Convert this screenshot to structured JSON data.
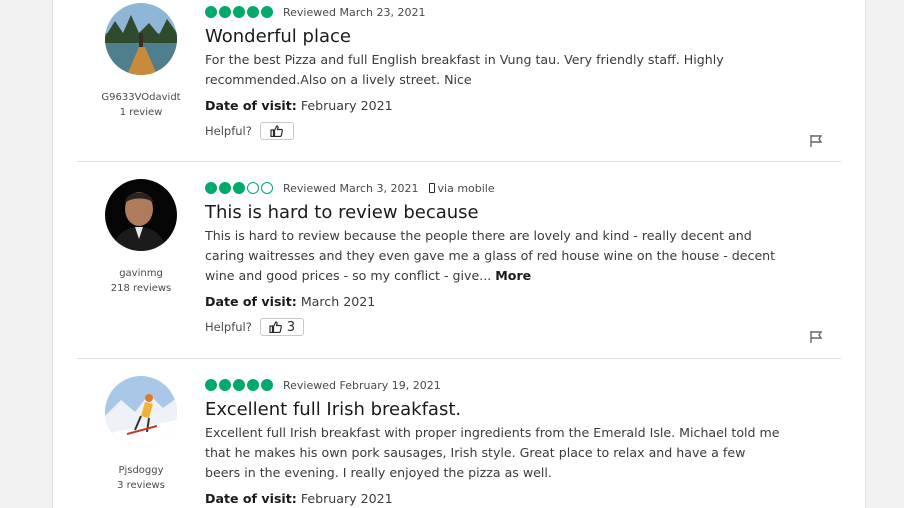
{
  "reviews": [
    {
      "username": "G9633VOdavidt",
      "review_count": "1 review",
      "rating": 5,
      "reviewed_date": "Reviewed March 23, 2021",
      "via": "",
      "title": "Wonderful place",
      "body_lines": [
        "For the best Pizza and full English breakfast in Vung tau. Very friendly staff. Highly",
        "recommended.Also on a lively street. Nice"
      ],
      "more": "",
      "date_label": "Date of visit:",
      "date_value": " February 2021",
      "helpful_label": "Helpful?",
      "helpful_count": ""
    },
    {
      "username": "gavinmg",
      "review_count": "218 reviews",
      "rating": 3,
      "reviewed_date": "Reviewed March 3, 2021",
      "via": "via mobile",
      "title": "This is hard to review because",
      "body_lines": [
        "This is hard to review because the people there are lovely and kind - really decent and",
        "caring waitresses and they even gave me a glass of red house wine on the house - decent",
        "wine and good prices - so my conflict - give..."
      ],
      "more": "More",
      "date_label": "Date of visit:",
      "date_value": " March 2021",
      "helpful_label": "Helpful?",
      "helpful_count": "3"
    },
    {
      "username": "Pjsdoggy",
      "review_count": "3 reviews",
      "rating": 5,
      "reviewed_date": "Reviewed February 19, 2021",
      "via": "",
      "title": "Excellent full Irish breakfast.",
      "body_lines": [
        "Excellent full Irish breakfast with proper ingredients from the Emerald Isle. Michael told me",
        "that he makes his own pork sausages, Irish style. Great place to relax and have a few",
        "beers in the evening. I really enjoyed the pizza as well."
      ],
      "more": "",
      "date_label": "Date of visit:",
      "date_value": " February 2021"
    }
  ],
  "colors": {
    "bubble": "#00aa6c",
    "divider": "#e0e0e0"
  },
  "icons": {
    "thumb": "thumbs-up-icon",
    "flag": "flag-icon",
    "mobile": "mobile-phone-icon"
  }
}
